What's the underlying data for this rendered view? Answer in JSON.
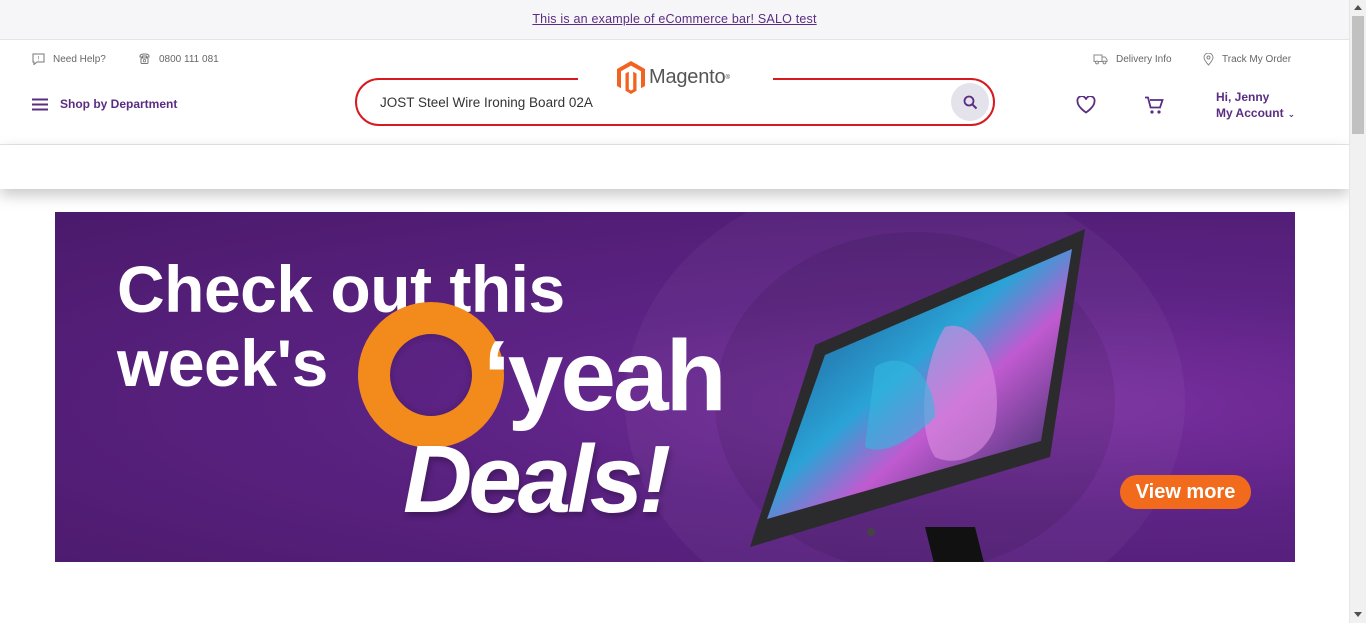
{
  "promo_bar": {
    "text": "This is an example of eCommerce bar! SALO test "
  },
  "header": {
    "need_help": "Need Help?",
    "phone": "0800 111 081",
    "delivery_info": "Delivery Info",
    "track_order": "Track My Order",
    "logo_text": "Magento",
    "shop_by_department": "Shop by Department",
    "search": {
      "value": "JOST Steel Wire Ironing Board 02A",
      "placeholder": ""
    },
    "account": {
      "greeting": "Hi, Jenny",
      "label": "My Account"
    }
  },
  "banner": {
    "line1": "Check out this",
    "line2": "week's",
    "yeah": "‘yeah",
    "deals": "Deals!",
    "cta": "View more"
  },
  "colors": {
    "brand": "#5a2d82",
    "accent": "#f26b1d",
    "search_border": "#d71920",
    "logo": "#f26322"
  },
  "icons": [
    "chat-help-icon",
    "phone-icon",
    "truck-icon",
    "map-pin-icon",
    "hamburger-icon",
    "search-icon",
    "heart-icon",
    "cart-icon",
    "chevron-down-icon"
  ]
}
